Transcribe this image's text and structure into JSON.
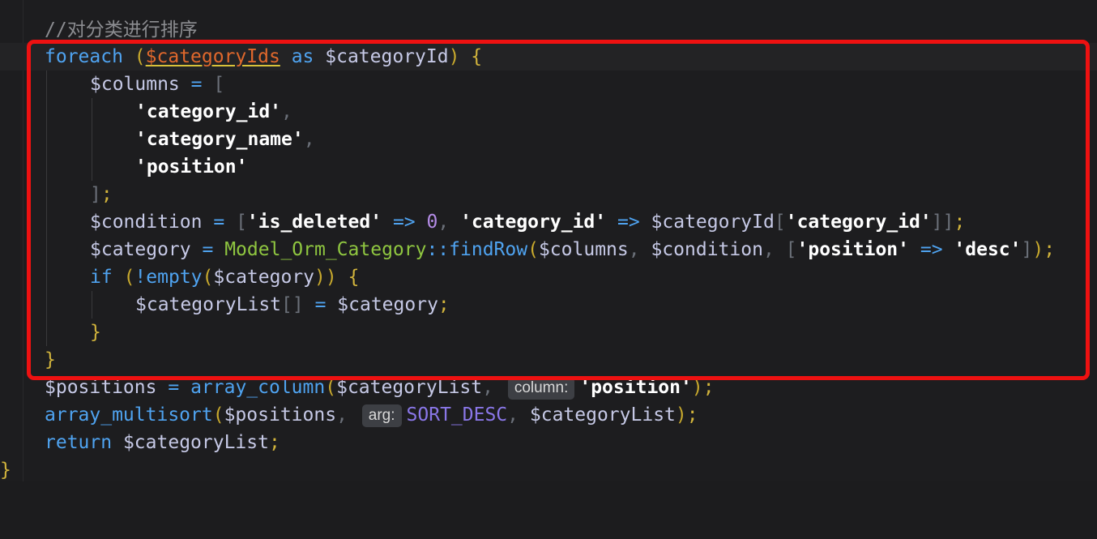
{
  "editor": {
    "comment": "//对分类进行排序",
    "foreach_kw": "foreach",
    "foreach_iterable": "$categoryIds",
    "as_kw": "as",
    "loop_var": "$categoryId",
    "columns_var": "$columns",
    "col1": "'category_id'",
    "col2": "'category_name'",
    "col3": "'position'",
    "condition_var": "$condition",
    "is_deleted": "'is_deleted'",
    "zero": "0",
    "category_id_key": "'category_id'",
    "category_id_index": "'category_id'",
    "category_var": "$category",
    "model_class": "Model_Orm_Category",
    "find_row": "findRow",
    "position_key": "'position'",
    "desc_val": "'desc'",
    "if_kw": "if",
    "empty_fn": "empty",
    "category_list": "$categoryList",
    "positions_var": "$positions",
    "array_column_fn": "array_column",
    "hint_column": "column:",
    "array_multisort_fn": "array_multisort",
    "hint_arg": "arg:",
    "sort_desc": "SORT_DESC",
    "return_kw": "return"
  },
  "highlight": {
    "color": "#ee1111"
  }
}
